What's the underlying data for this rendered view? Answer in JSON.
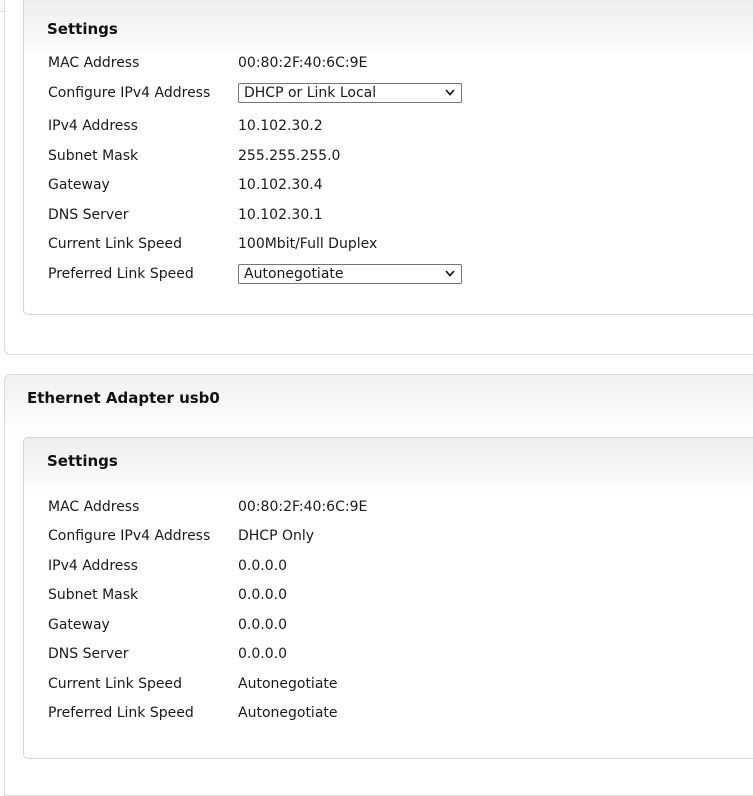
{
  "panels": [
    {
      "settings": {
        "title": "Settings",
        "rows": [
          {
            "label": "MAC Address",
            "value": "00:80:2F:40:6C:9E"
          },
          {
            "label": "Configure IPv4 Address",
            "value": "DHCP or Link Local",
            "type": "select"
          },
          {
            "label": "IPv4 Address",
            "value": "10.102.30.2"
          },
          {
            "label": "Subnet Mask",
            "value": "255.255.255.0"
          },
          {
            "label": "Gateway",
            "value": "10.102.30.4"
          },
          {
            "label": "DNS Server",
            "value": "10.102.30.1"
          },
          {
            "label": "Current Link Speed",
            "value": "100Mbit/Full Duplex"
          },
          {
            "label": "Preferred Link Speed",
            "value": "Autonegotiate",
            "type": "select"
          }
        ]
      }
    },
    {
      "title": "Ethernet Adapter usb0",
      "settings": {
        "title": "Settings",
        "rows": [
          {
            "label": "MAC Address",
            "value": "00:80:2F:40:6C:9E"
          },
          {
            "label": "Configure IPv4 Address",
            "value": "DHCP Only"
          },
          {
            "label": "IPv4 Address",
            "value": "0.0.0.0"
          },
          {
            "label": "Subnet Mask",
            "value": "0.0.0.0"
          },
          {
            "label": "Gateway",
            "value": "0.0.0.0"
          },
          {
            "label": "DNS Server",
            "value": "0.0.0.0"
          },
          {
            "label": "Current Link Speed",
            "value": "Autonegotiate"
          },
          {
            "label": "Preferred Link Speed",
            "value": "Autonegotiate"
          }
        ]
      }
    }
  ],
  "icons": {
    "select_arrow": "chevron-down-icon"
  }
}
